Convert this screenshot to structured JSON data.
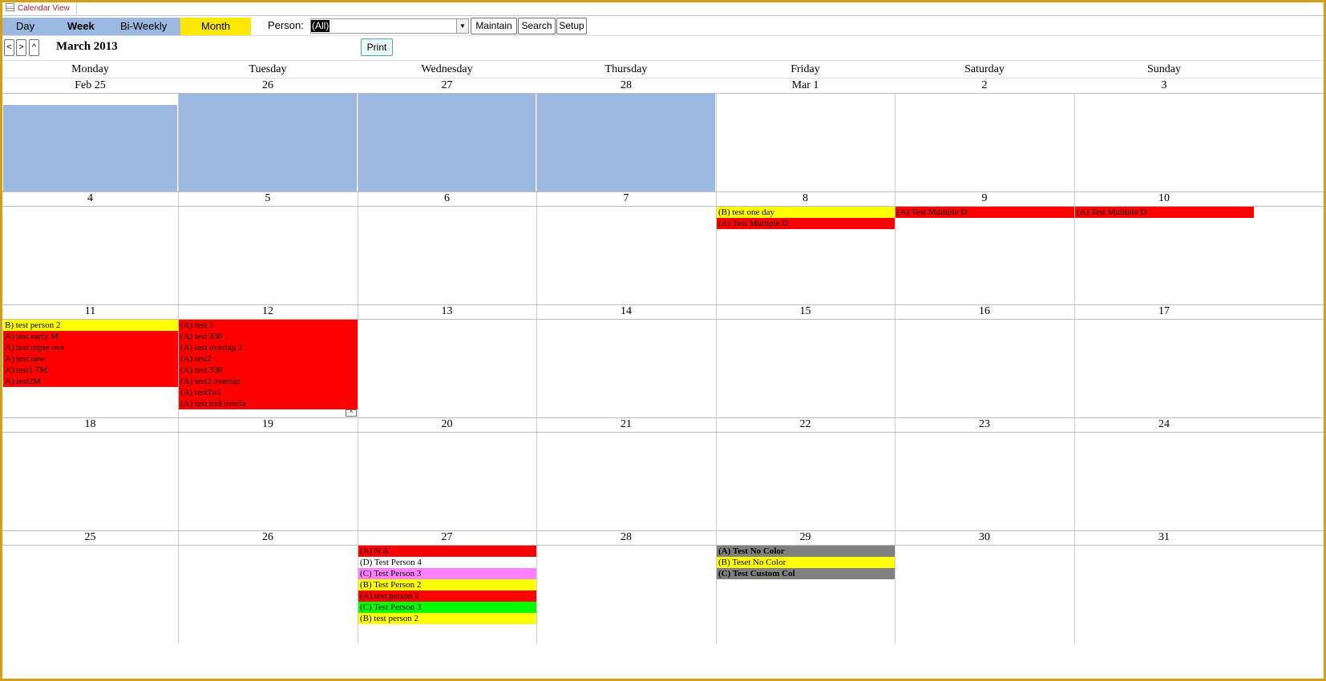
{
  "window": {
    "tab_title": "Calendar View"
  },
  "view_tabs": {
    "day": "Day",
    "week": "Week",
    "biweekly": "Bi-Weekly",
    "month": "Month"
  },
  "person": {
    "label": "Person:",
    "value": "(All)"
  },
  "toolbar": {
    "maintain": "Maintain",
    "search": "Search",
    "setup": "Setup",
    "print": "Print"
  },
  "nav": {
    "prev": "<",
    "next": ">",
    "up": "^"
  },
  "month_title": "March 2013",
  "colors": {
    "month_tab": "#ffe800",
    "view_tab": "#9ab8e0",
    "outside_month": "#9ab8e0",
    "red": "#ff0000",
    "yellow": "#ffff00",
    "pink": "#ff80ff",
    "green": "#00ff00",
    "gray": "#808080"
  },
  "day_names": [
    "Monday",
    "Tuesday",
    "Wednesday",
    "Thursday",
    "Friday",
    "Saturday",
    "Sunday"
  ],
  "weeks": [
    {
      "days": [
        {
          "label": "Feb 25",
          "outside": true,
          "events": []
        },
        {
          "label": "26",
          "outside": true,
          "events": []
        },
        {
          "label": "27",
          "outside": true,
          "events": []
        },
        {
          "label": "28",
          "outside": true,
          "events": []
        },
        {
          "label": "Mar 1",
          "events": []
        },
        {
          "label": "2",
          "events": []
        },
        {
          "label": "3",
          "events": []
        }
      ]
    },
    {
      "days": [
        {
          "label": "4",
          "events": []
        },
        {
          "label": "5",
          "events": []
        },
        {
          "label": "6",
          "events": []
        },
        {
          "label": "7",
          "events": []
        },
        {
          "label": "8",
          "events": [
            {
              "text": "(B) test one day",
              "color": "#ffff00"
            },
            {
              "text": "(A) Test Multiple D",
              "color": "#ff0000"
            }
          ]
        },
        {
          "label": "9",
          "events": [
            {
              "text": "(A) Test Multiple D",
              "color": "#ff0000"
            }
          ]
        },
        {
          "label": "10",
          "events": [
            {
              "text": "(A) Test Multiple D",
              "color": "#ff0000"
            }
          ]
        }
      ]
    },
    {
      "days": [
        {
          "label": "11",
          "events": [
            {
              "text": "B) test person 2",
              "color": "#ffff00"
            },
            {
              "text": "A) test early M",
              "color": "#ff0000"
            },
            {
              "text": "A) test triple ove",
              "color": "#ff0000"
            },
            {
              "text": "A) test new",
              "color": "#ff0000"
            },
            {
              "text": "A) test1 7M",
              "color": "#ff0000"
            },
            {
              "text": "A) test2M",
              "color": "#ff0000"
            }
          ]
        },
        {
          "label": "12",
          "more": "^",
          "events": [
            {
              "text": "(A) test 1",
              "color": "#ff0000"
            },
            {
              "text": "(A) test 330",
              "color": "#ff0000"
            },
            {
              "text": "(A) test overlap 2",
              "color": "#ff0000"
            },
            {
              "text": "(A) test2",
              "color": "#ff0000"
            },
            {
              "text": "(A) test 330",
              "color": "#ff0000"
            },
            {
              "text": "(A) test2 overlap",
              "color": "#ff0000"
            },
            {
              "text": "(A) testTu1",
              "color": "#ff0000"
            },
            {
              "text": "(A) test trid overla",
              "color": "#ff0000"
            }
          ]
        },
        {
          "label": "13",
          "events": []
        },
        {
          "label": "14",
          "events": []
        },
        {
          "label": "15",
          "events": []
        },
        {
          "label": "16",
          "events": []
        },
        {
          "label": "17",
          "events": []
        }
      ]
    },
    {
      "days": [
        {
          "label": "18",
          "events": []
        },
        {
          "label": "19",
          "events": []
        },
        {
          "label": "20",
          "events": []
        },
        {
          "label": "21",
          "events": []
        },
        {
          "label": "22",
          "events": []
        },
        {
          "label": "23",
          "events": []
        },
        {
          "label": "24",
          "events": []
        }
      ]
    },
    {
      "days": [
        {
          "label": "25",
          "events": []
        },
        {
          "label": "26",
          "events": []
        },
        {
          "label": "27",
          "events": [
            {
              "text": "(A) N A",
              "color": "#ff0000"
            },
            {
              "text": "(D) Test Person 4",
              "color": "#ffffff"
            },
            {
              "text": "(C) Test Person 3",
              "color": "#ff80ff"
            },
            {
              "text": "(B) Test Person 2",
              "color": "#ffff00"
            },
            {
              "text": "(A) test person 1",
              "color": "#ff0000"
            },
            {
              "text": "(C) Test Person 3",
              "color": "#00ff00"
            },
            {
              "text": "(B) test person 2",
              "color": "#ffff00"
            }
          ]
        },
        {
          "label": "28",
          "events": []
        },
        {
          "label": "29",
          "events": [
            {
              "text": "(A) Test No Color",
              "color": "#808080",
              "bold": true
            },
            {
              "text": "(B) Teset No Color",
              "color": "#ffff00"
            },
            {
              "text": "(C) Test Custom Col",
              "color": "#808080",
              "bold": true
            }
          ]
        },
        {
          "label": "30",
          "events": []
        },
        {
          "label": "31",
          "events": []
        }
      ]
    }
  ]
}
